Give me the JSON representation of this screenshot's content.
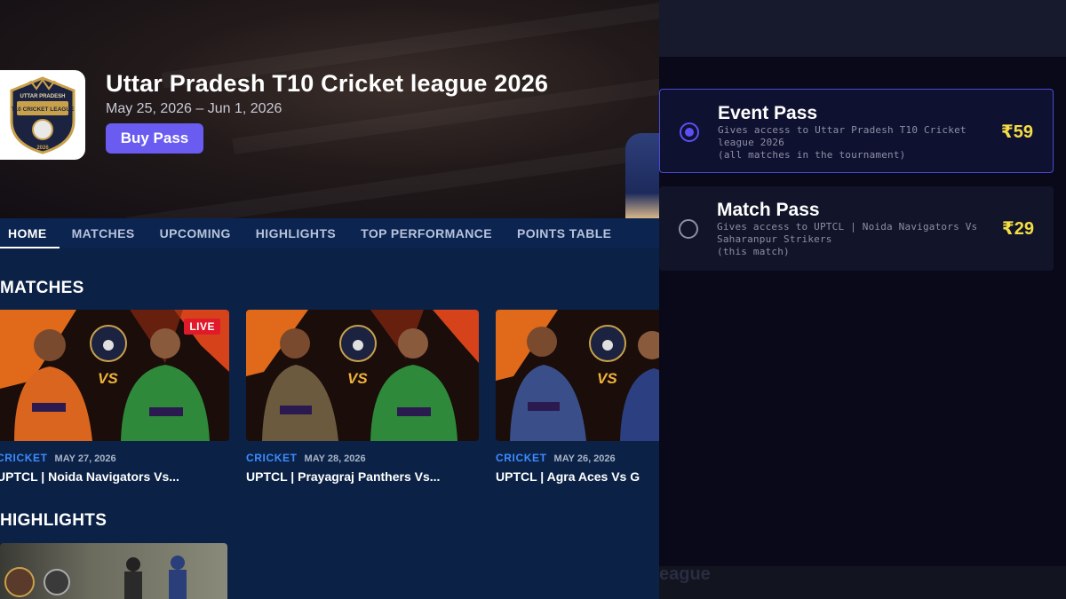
{
  "event": {
    "title": "Uttar Pradesh T10 Cricket league 2026",
    "dates": "May 25, 2026 – Jun 1, 2026",
    "buy_label": "Buy Pass",
    "logo_text_top": "UTTAR PRADESH",
    "logo_text_main": "T10 CRICKET LEAGUE",
    "logo_year": "2026"
  },
  "tabs": [
    "HOME",
    "MATCHES",
    "UPCOMING",
    "HIGHLIGHTS",
    "TOP PERFORMANCE",
    "POINTS TABLE"
  ],
  "sections": {
    "matches": "MATCHES",
    "highlights": "HIGHLIGHTS"
  },
  "matches": [
    {
      "category": "CRICKET",
      "date": "MAY 27, 2026",
      "title": "UPTCL | Noida Navigators Vs...",
      "badge": "LIVE",
      "vs": "VS",
      "left_jersey": "#d9651f",
      "right_jersey": "#2e8a3a"
    },
    {
      "category": "CRICKET",
      "date": "MAY 28, 2026",
      "title": "UPTCL | Prayagraj Panthers Vs...",
      "vs": "VS",
      "left_jersey": "#6b5a3e",
      "right_jersey": "#2e8a3a"
    },
    {
      "category": "CRICKET",
      "date": "MAY 26, 2026",
      "title": "UPTCL | Agra Aces Vs G",
      "vs": "VS",
      "left_jersey": "#3a4f8a",
      "right_jersey": "#2c3f80"
    }
  ],
  "passes": [
    {
      "name": "Event Pass",
      "desc": [
        "Gives access to Uttar Pradesh T10 Cricket",
        "league 2026",
        "(all matches in the tournament)"
      ],
      "price": "₹59",
      "selected": true
    },
    {
      "name": "Match Pass",
      "desc": [
        "Gives access to UPTCL | Noida Navigators Vs",
        "Saharanpur Strikers",
        "(this match)"
      ],
      "price": "₹29",
      "selected": false
    }
  ],
  "ghost_text": "eague",
  "colors": {
    "accent": "#6a5cf0",
    "price": "#f4dd45",
    "live": "#e01a2b",
    "category": "#3d8bff"
  }
}
